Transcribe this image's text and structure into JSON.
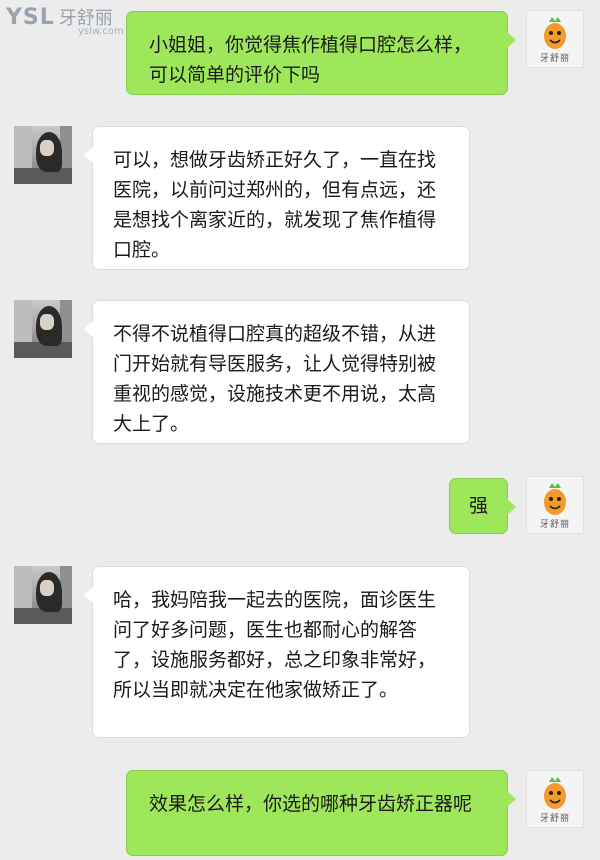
{
  "watermark": {
    "logo": "YSL",
    "name_cn": "牙舒丽",
    "url": "yslw.com"
  },
  "brand_avatar": {
    "label": "牙舒丽",
    "accent": "#f39a2b"
  },
  "colors": {
    "outgoing_bubble": "#9ee65a",
    "incoming_bubble": "#ffffff",
    "background": "#ececec"
  },
  "messages": [
    {
      "side": "out",
      "text": "小姐姐，你觉得焦作植得口腔怎么样，可以简单的评价下吗"
    },
    {
      "side": "in",
      "text": "可以，想做牙齿矫正好久了，一直在找医院，以前问过郑州的，但有点远，还是想找个离家近的，就发现了焦作植得口腔。"
    },
    {
      "side": "in",
      "text": "不得不说植得口腔真的超级不错，从进门开始就有导医服务，让人觉得特别被重视的感觉，设施技术更不用说，太高大上了。"
    },
    {
      "side": "out",
      "text": "强"
    },
    {
      "side": "in",
      "text": "哈，我妈陪我一起去的医院，面诊医生问了好多问题，医生也都耐心的解答了，设施服务都好，总之印象非常好，所以当即就决定在他家做矫正了。"
    },
    {
      "side": "out",
      "text": "效果怎么样，你选的哪种牙齿矫正器呢"
    }
  ]
}
